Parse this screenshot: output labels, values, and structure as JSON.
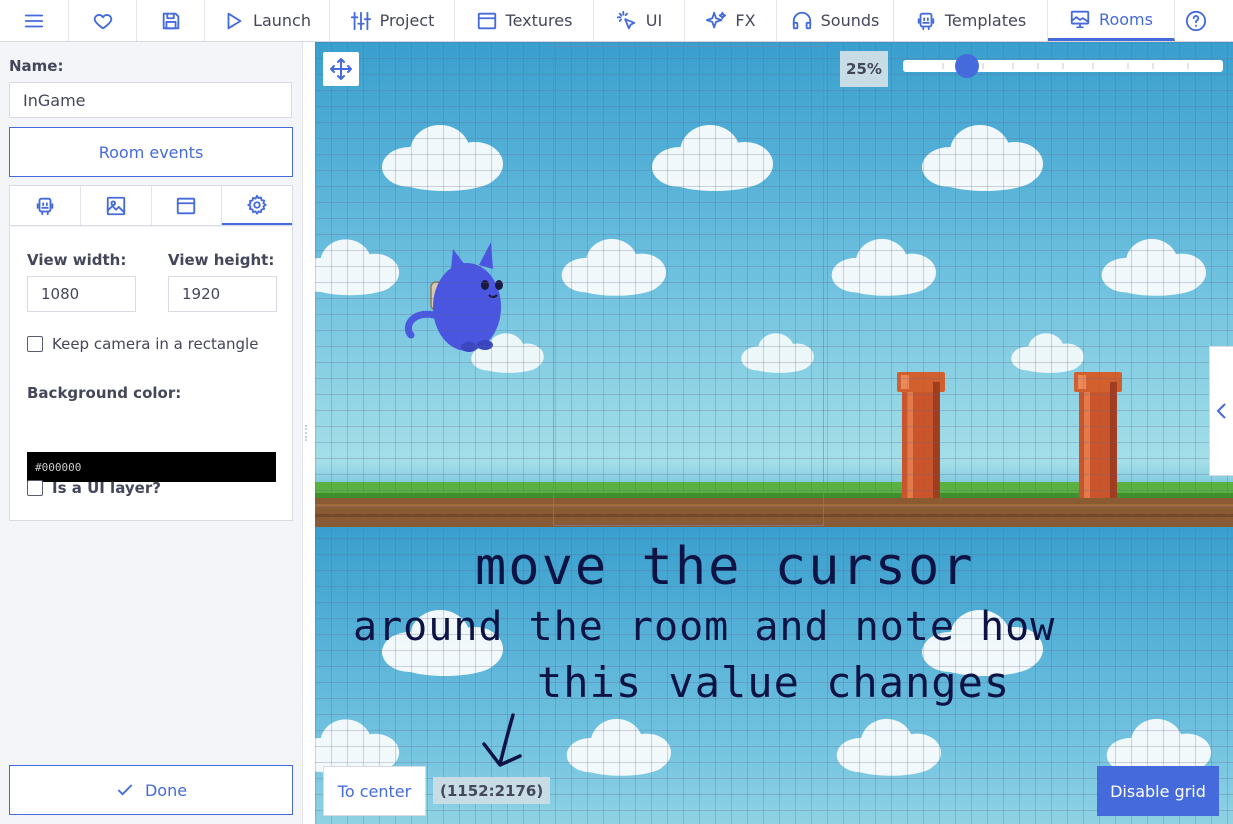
{
  "nav": {
    "launch": "Launch",
    "project": "Project",
    "textures": "Textures",
    "ui": "UI",
    "fx": "FX",
    "sounds": "Sounds",
    "templates": "Templates",
    "rooms": "Rooms"
  },
  "room": {
    "name_label": "Name:",
    "name_value": "InGame",
    "events_button": "Room events"
  },
  "properties": {
    "view_width_label": "View width:",
    "view_width_value": "1080",
    "view_height_label": "View height:",
    "view_height_value": "1920",
    "keep_camera_label": "Keep camera in a rectangle",
    "keep_camera_checked": false,
    "bg_color_label": "Background color:",
    "bg_color_value": "#000000",
    "ui_layer_label": "Is a UI layer?",
    "ui_layer_checked": false
  },
  "done_label": "Done",
  "canvas": {
    "zoom": "25%",
    "zoom_level": 0.2,
    "to_center": "To center",
    "coords": "(1152:2176)",
    "disable_grid": "Disable grid"
  },
  "annotation": {
    "line1": "move the cursor",
    "line2": "around the room and note how",
    "line3": "this value changes"
  },
  "colors": {
    "accent": "#446adb",
    "bg_swatch": "#000000"
  }
}
